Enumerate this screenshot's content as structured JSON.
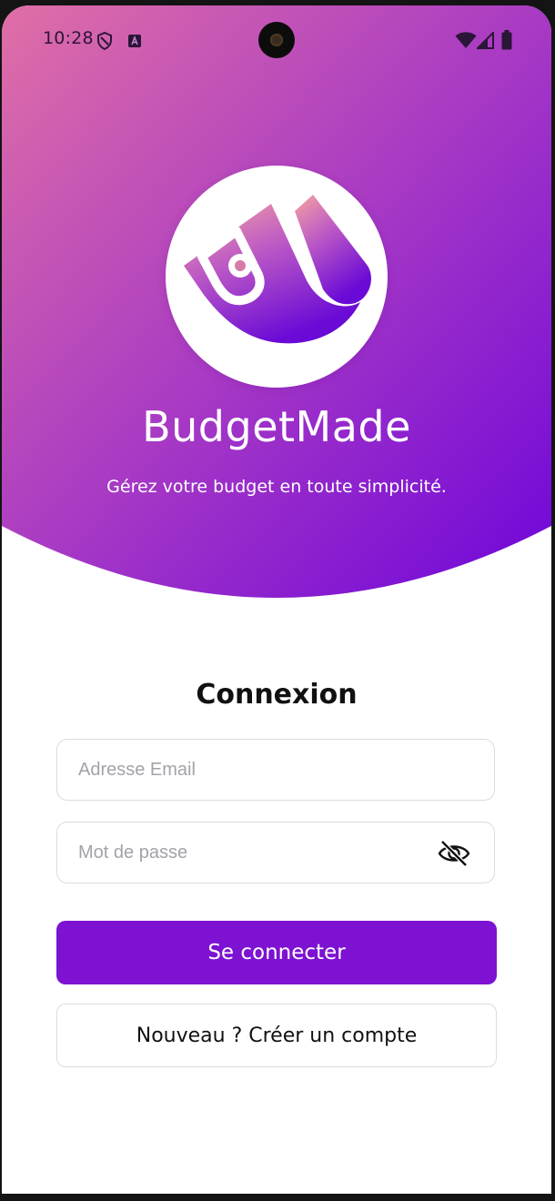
{
  "status_bar": {
    "time": "10:28",
    "icons": [
      "shield-icon",
      "keyboard-a-icon",
      "wifi-icon",
      "signal-icon",
      "battery-icon"
    ]
  },
  "hero": {
    "gradient_start": "#e06fa6",
    "gradient_mid": "#a336c4",
    "gradient_end": "#7006d8",
    "logo_icon": "budgetmade-logo-icon",
    "app_name": "BudgetMade",
    "tagline": "Gérez votre budget en toute simplicité."
  },
  "login": {
    "title": "Connexion",
    "email_placeholder": "Adresse Email",
    "email_value": "",
    "password_placeholder": "Mot de passe",
    "password_value": "",
    "password_toggle_icon": "eye-off-icon",
    "submit_label": "Se connecter",
    "register_label": "Nouveau ? Créer un compte",
    "primary_color": "#7d12d3"
  }
}
